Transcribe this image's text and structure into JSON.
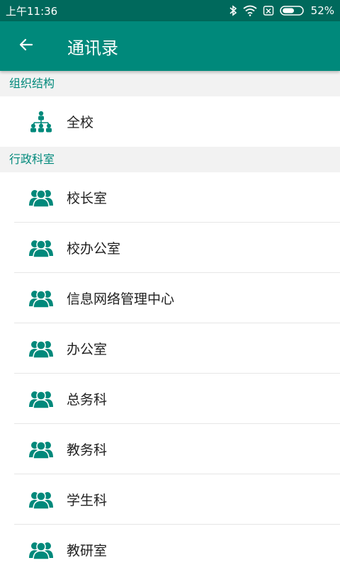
{
  "status": {
    "time": "上午11:36",
    "battery": "52%"
  },
  "header": {
    "title": "通讯录"
  },
  "sections": [
    {
      "title": "组织结构",
      "items": [
        {
          "label": "全校",
          "icon": "org-chart-icon"
        }
      ]
    },
    {
      "title": "行政科室",
      "items": [
        {
          "label": "校长室",
          "icon": "group-icon"
        },
        {
          "label": "校办公室",
          "icon": "group-icon"
        },
        {
          "label": "信息网络管理中心",
          "icon": "group-icon"
        },
        {
          "label": "办公室",
          "icon": "group-icon"
        },
        {
          "label": "总务科",
          "icon": "group-icon"
        },
        {
          "label": "教务科",
          "icon": "group-icon"
        },
        {
          "label": "学生科",
          "icon": "group-icon"
        },
        {
          "label": "教研室",
          "icon": "group-icon"
        }
      ]
    }
  ],
  "colors": {
    "status_bar": "#00695c",
    "app_bar": "#00897b",
    "accent": "#00897b"
  }
}
